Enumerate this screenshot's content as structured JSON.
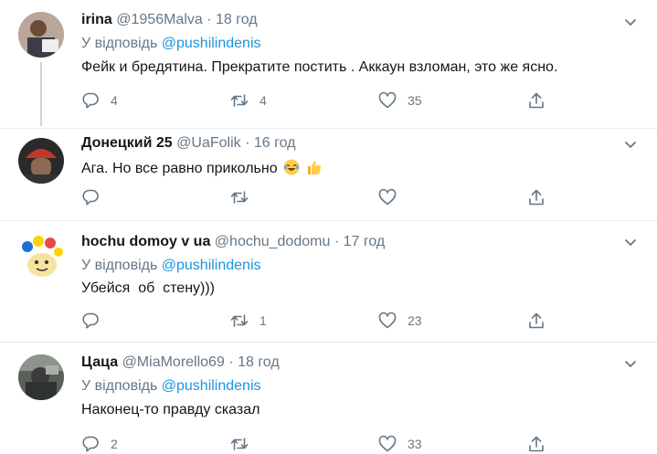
{
  "tweets": [
    {
      "name": "irina",
      "handle": "@1956Malva",
      "dot": "·",
      "time": "18 год",
      "reply_prefix": "У відповідь",
      "reply_to": "@pushilindenis",
      "text": "Фейк и бредятина. Прекратите постить . Аккаун взломан, это же ясно.",
      "replies": "4",
      "retweets": "4",
      "likes": "35"
    },
    {
      "name": "Донецкий 25",
      "handle": "@UaFolik",
      "dot": "·",
      "time": "16 год",
      "text": "Ага. Но все равно прикольно",
      "emojis": [
        "face-with-tears-of-joy-icon",
        "thumbs-up-icon"
      ],
      "replies": "",
      "retweets": "",
      "likes": ""
    },
    {
      "name": "hochu domoy v ua",
      "handle": "@hochu_dodomu",
      "dot": "·",
      "time": "17 год",
      "reply_prefix": "У відповідь",
      "reply_to": "@pushilindenis",
      "text": "Убейся  об  стену)))",
      "replies": "",
      "retweets": "1",
      "likes": "23"
    },
    {
      "name": "Цаца",
      "handle": "@MiaMorello69",
      "dot": "·",
      "time": "18 год",
      "reply_prefix": "У відповідь",
      "reply_to": "@pushilindenis",
      "text": "Наконец-то правду сказал",
      "replies": "2",
      "retweets": "",
      "likes": "33"
    }
  ],
  "colors": {
    "accent": "#1b95e0",
    "secondary_text": "#657786",
    "icon": "#657786",
    "divider": "#e6ecf0"
  }
}
